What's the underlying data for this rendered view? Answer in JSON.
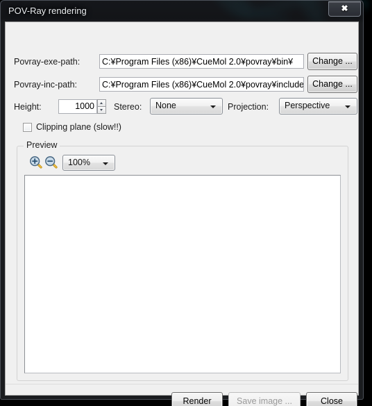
{
  "window": {
    "title": "POV-Ray rendering",
    "close_label": "✖"
  },
  "form": {
    "exe_path_label": "Povray-exe-path:",
    "exe_path_value": "C:¥Program Files (x86)¥CueMol 2.0¥povray¥bin¥",
    "exe_path_placeholder": "",
    "exe_change_label": "Change ...",
    "inc_path_label": "Povray-inc-path:",
    "inc_path_value": "C:¥Program Files (x86)¥CueMol 2.0¥povray¥include",
    "inc_path_placeholder": "",
    "inc_change_label": "Change ...",
    "height_label": "Height:",
    "height_value": "1000",
    "stereo_label": "Stereo:",
    "stereo_value": "None",
    "stereo_options": [
      "None"
    ],
    "projection_label": "Projection:",
    "projection_value": "Perspective",
    "projection_options": [
      "Perspective"
    ],
    "clipping_label": "Clipping plane (slow!!)",
    "clipping_checked": false
  },
  "preview": {
    "group_label": "Preview",
    "zoom_in_icon": "zoom-in-icon",
    "zoom_out_icon": "zoom-out-icon",
    "zoom_value": "100%",
    "zoom_options": [
      "100%"
    ]
  },
  "footer": {
    "render_label": "Render",
    "save_image_label": "Save image ...",
    "save_image_disabled": true,
    "close_label": "Close"
  },
  "colors": {
    "dialog_bg": "#f0f0f0",
    "glass_dark": "#16181c",
    "glass_accent": "#1e96aa",
    "text": "#1b1b1b",
    "disabled_text": "#9a9a9a"
  }
}
